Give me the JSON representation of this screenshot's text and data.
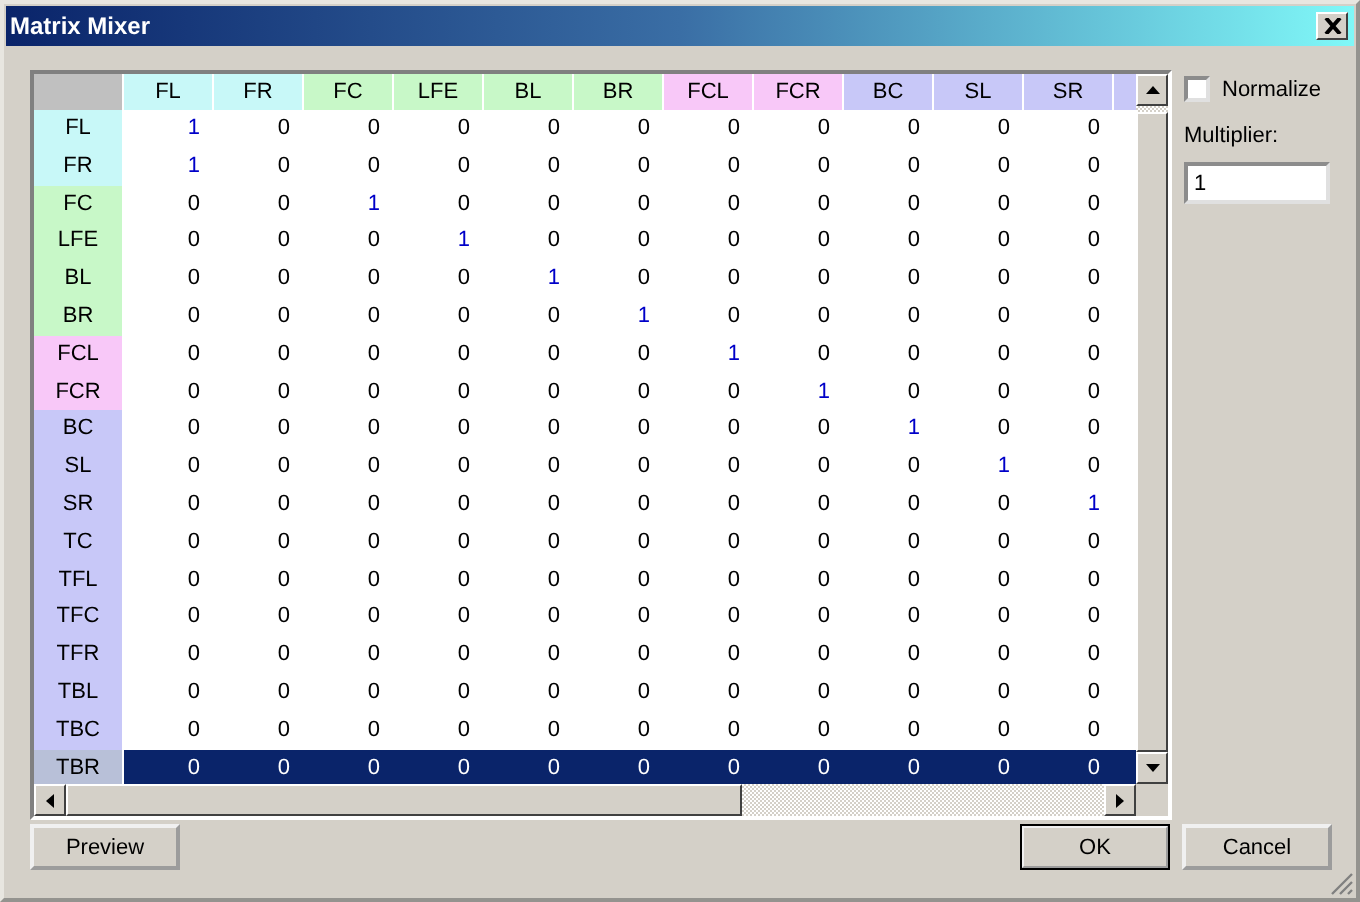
{
  "window": {
    "title": "Matrix Mixer"
  },
  "columns": [
    {
      "label": "FL",
      "color": "#c8f8f8"
    },
    {
      "label": "FR",
      "color": "#c8f8f8"
    },
    {
      "label": "FC",
      "color": "#c8f8c8"
    },
    {
      "label": "LFE",
      "color": "#c8f8c8"
    },
    {
      "label": "BL",
      "color": "#c8f8c8"
    },
    {
      "label": "BR",
      "color": "#c8f8c8"
    },
    {
      "label": "FCL",
      "color": "#f8c8f8"
    },
    {
      "label": "FCR",
      "color": "#f8c8f8"
    },
    {
      "label": "BC",
      "color": "#c8c8f8"
    },
    {
      "label": "SL",
      "color": "#c8c8f8"
    },
    {
      "label": "SR",
      "color": "#c8c8f8"
    },
    {
      "color": "#c8c8f8"
    }
  ],
  "rows": [
    {
      "label": "FL",
      "color": "#c8f8f8",
      "selected": false,
      "cells": [
        "1",
        "0",
        "0",
        "0",
        "0",
        "0",
        "0",
        "0",
        "0",
        "0",
        "0"
      ],
      "emphasized": [
        true,
        false,
        false,
        false,
        false,
        false,
        false,
        false,
        false,
        false,
        false
      ]
    },
    {
      "label": "FR",
      "color": "#c8f8f8",
      "selected": false,
      "cells": [
        "1",
        "0",
        "0",
        "0",
        "0",
        "0",
        "0",
        "0",
        "0",
        "0",
        "0"
      ],
      "emphasized": [
        true,
        false,
        false,
        false,
        false,
        false,
        false,
        false,
        false,
        false,
        false
      ]
    },
    {
      "label": "FC",
      "color": "#c8f8c8",
      "selected": false,
      "cells": [
        "0",
        "0",
        "1",
        "0",
        "0",
        "0",
        "0",
        "0",
        "0",
        "0",
        "0"
      ],
      "emphasized": [
        false,
        false,
        true,
        false,
        false,
        false,
        false,
        false,
        false,
        false,
        false
      ]
    },
    {
      "label": "LFE",
      "color": "#c8f8c8",
      "selected": false,
      "cells": [
        "0",
        "0",
        "0",
        "1",
        "0",
        "0",
        "0",
        "0",
        "0",
        "0",
        "0"
      ],
      "emphasized": [
        false,
        false,
        false,
        true,
        false,
        false,
        false,
        false,
        false,
        false,
        false
      ]
    },
    {
      "label": "BL",
      "color": "#c8f8c8",
      "selected": false,
      "cells": [
        "0",
        "0",
        "0",
        "0",
        "1",
        "0",
        "0",
        "0",
        "0",
        "0",
        "0"
      ],
      "emphasized": [
        false,
        false,
        false,
        false,
        true,
        false,
        false,
        false,
        false,
        false,
        false
      ]
    },
    {
      "label": "BR",
      "color": "#c8f8c8",
      "selected": false,
      "cells": [
        "0",
        "0",
        "0",
        "0",
        "0",
        "1",
        "0",
        "0",
        "0",
        "0",
        "0"
      ],
      "emphasized": [
        false,
        false,
        false,
        false,
        false,
        true,
        false,
        false,
        false,
        false,
        false
      ]
    },
    {
      "label": "FCL",
      "color": "#f8c8f8",
      "selected": false,
      "cells": [
        "0",
        "0",
        "0",
        "0",
        "0",
        "0",
        "1",
        "0",
        "0",
        "0",
        "0"
      ],
      "emphasized": [
        false,
        false,
        false,
        false,
        false,
        false,
        true,
        false,
        false,
        false,
        false
      ]
    },
    {
      "label": "FCR",
      "color": "#f8c8f8",
      "selected": false,
      "cells": [
        "0",
        "0",
        "0",
        "0",
        "0",
        "0",
        "0",
        "1",
        "0",
        "0",
        "0"
      ],
      "emphasized": [
        false,
        false,
        false,
        false,
        false,
        false,
        false,
        true,
        false,
        false,
        false
      ]
    },
    {
      "label": "BC",
      "color": "#c8c8f8",
      "selected": false,
      "cells": [
        "0",
        "0",
        "0",
        "0",
        "0",
        "0",
        "0",
        "0",
        "1",
        "0",
        "0"
      ],
      "emphasized": [
        false,
        false,
        false,
        false,
        false,
        false,
        false,
        false,
        true,
        false,
        false
      ]
    },
    {
      "label": "SL",
      "color": "#c8c8f8",
      "selected": false,
      "cells": [
        "0",
        "0",
        "0",
        "0",
        "0",
        "0",
        "0",
        "0",
        "0",
        "1",
        "0"
      ],
      "emphasized": [
        false,
        false,
        false,
        false,
        false,
        false,
        false,
        false,
        false,
        true,
        false
      ]
    },
    {
      "label": "SR",
      "color": "#c8c8f8",
      "selected": false,
      "cells": [
        "0",
        "0",
        "0",
        "0",
        "0",
        "0",
        "0",
        "0",
        "0",
        "0",
        "1"
      ],
      "emphasized": [
        false,
        false,
        false,
        false,
        false,
        false,
        false,
        false,
        false,
        false,
        true
      ]
    },
    {
      "label": "TC",
      "color": "#c8c8f8",
      "selected": false,
      "cells": [
        "0",
        "0",
        "0",
        "0",
        "0",
        "0",
        "0",
        "0",
        "0",
        "0",
        "0"
      ],
      "emphasized": [
        false,
        false,
        false,
        false,
        false,
        false,
        false,
        false,
        false,
        false,
        false
      ]
    },
    {
      "label": "TFL",
      "color": "#c8c8f8",
      "selected": false,
      "cells": [
        "0",
        "0",
        "0",
        "0",
        "0",
        "0",
        "0",
        "0",
        "0",
        "0",
        "0"
      ],
      "emphasized": [
        false,
        false,
        false,
        false,
        false,
        false,
        false,
        false,
        false,
        false,
        false
      ]
    },
    {
      "label": "TFC",
      "color": "#c8c8f8",
      "selected": false,
      "cells": [
        "0",
        "0",
        "0",
        "0",
        "0",
        "0",
        "0",
        "0",
        "0",
        "0",
        "0"
      ],
      "emphasized": [
        false,
        false,
        false,
        false,
        false,
        false,
        false,
        false,
        false,
        false,
        false
      ]
    },
    {
      "label": "TFR",
      "color": "#c8c8f8",
      "selected": false,
      "cells": [
        "0",
        "0",
        "0",
        "0",
        "0",
        "0",
        "0",
        "0",
        "0",
        "0",
        "0"
      ],
      "emphasized": [
        false,
        false,
        false,
        false,
        false,
        false,
        false,
        false,
        false,
        false,
        false
      ]
    },
    {
      "label": "TBL",
      "color": "#c8c8f8",
      "selected": false,
      "cells": [
        "0",
        "0",
        "0",
        "0",
        "0",
        "0",
        "0",
        "0",
        "0",
        "0",
        "0"
      ],
      "emphasized": [
        false,
        false,
        false,
        false,
        false,
        false,
        false,
        false,
        false,
        false,
        false
      ]
    },
    {
      "label": "TBC",
      "color": "#c8c8f8",
      "selected": false,
      "cells": [
        "0",
        "0",
        "0",
        "0",
        "0",
        "0",
        "0",
        "0",
        "0",
        "0",
        "0"
      ],
      "emphasized": [
        false,
        false,
        false,
        false,
        false,
        false,
        false,
        false,
        false,
        false,
        false
      ]
    },
    {
      "label": "TBR",
      "color": "#b8c0d8",
      "selected": true,
      "cells": [
        "0",
        "0",
        "0",
        "0",
        "0",
        "0",
        "0",
        "0",
        "0",
        "0",
        "0"
      ],
      "emphasized": [
        false,
        false,
        false,
        false,
        false,
        false,
        false,
        false,
        false,
        false,
        false
      ]
    }
  ],
  "normalize": {
    "label": "Normalize",
    "checked": false
  },
  "multiplier": {
    "label": "Multiplier:",
    "value": "1"
  },
  "buttons": [
    {
      "label": "Preview",
      "kind": "normal"
    },
    {
      "label": "OK",
      "kind": "default"
    },
    {
      "label": "Cancel",
      "kind": "normal"
    }
  ]
}
